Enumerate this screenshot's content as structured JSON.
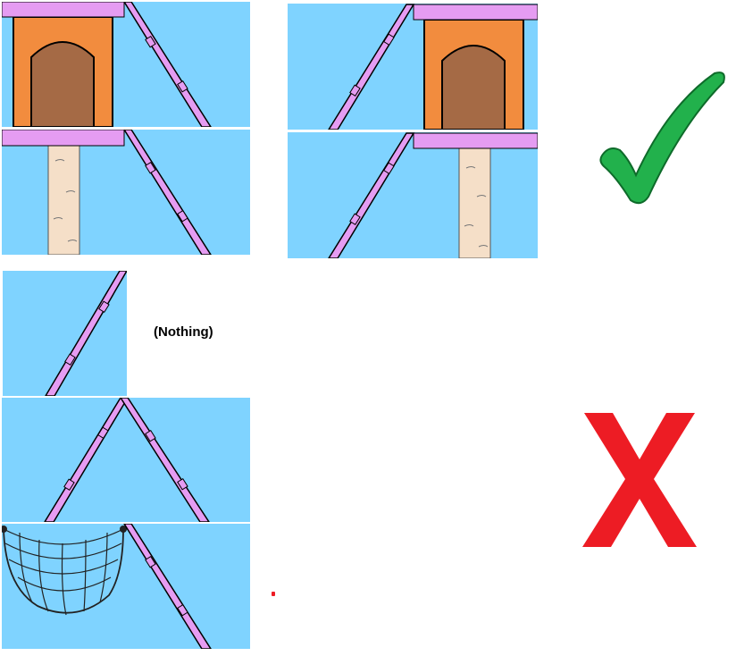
{
  "colors": {
    "sky": "#7fd3ff",
    "platform": "#e59cf2",
    "house_wall": "#f28c3e",
    "house_door": "#a56a45",
    "trunk": "#f5dfc8",
    "check": "#22b14c",
    "cross": "#ed1c24"
  },
  "correct_group": {
    "result_icon": "check-icon",
    "tiles": [
      "house-platform-ramp-right",
      "ramp-left-house-platform",
      "trunk-platform-ramp-right",
      "ramp-left-trunk-platform"
    ]
  },
  "incorrect_group": {
    "result_icon": "cross-icon",
    "tiles": [
      "ramp-left-only",
      "ramp-peak",
      "net-ramp-right"
    ],
    "empty_label": "(Nothing)"
  }
}
